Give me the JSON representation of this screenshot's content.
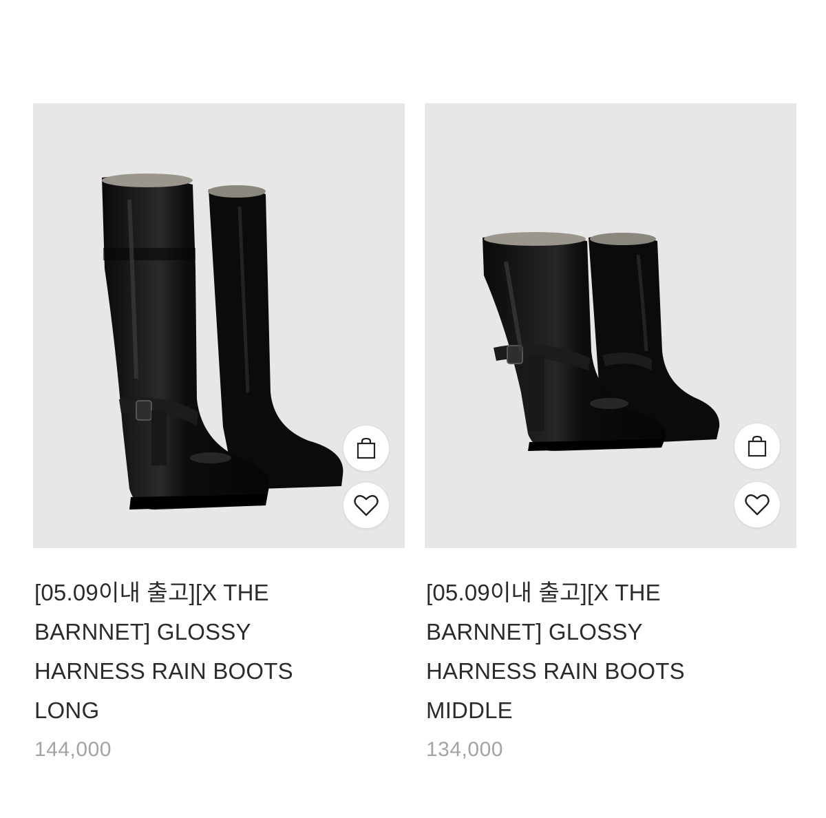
{
  "products": [
    {
      "title": "[05.09이내 출고][X THE BARNNET] GLOSSY HARNESS RAIN BOOTS LONG",
      "price": "144,000",
      "image_alt": "Glossy black long harness rain boots",
      "cart_icon": "shopping-bag-icon",
      "like_icon": "heart-icon"
    },
    {
      "title": "[05.09이내 출고][X THE BARNNET] GLOSSY HARNESS RAIN BOOTS MIDDLE",
      "price": "134,000",
      "image_alt": "Glossy black middle harness rain boots",
      "cart_icon": "shopping-bag-icon",
      "like_icon": "heart-icon"
    }
  ],
  "colors": {
    "thumb_bg": "#e7e7e7",
    "boot": "#111111",
    "title": "#2b2b2b",
    "price": "#a3a3a3"
  }
}
